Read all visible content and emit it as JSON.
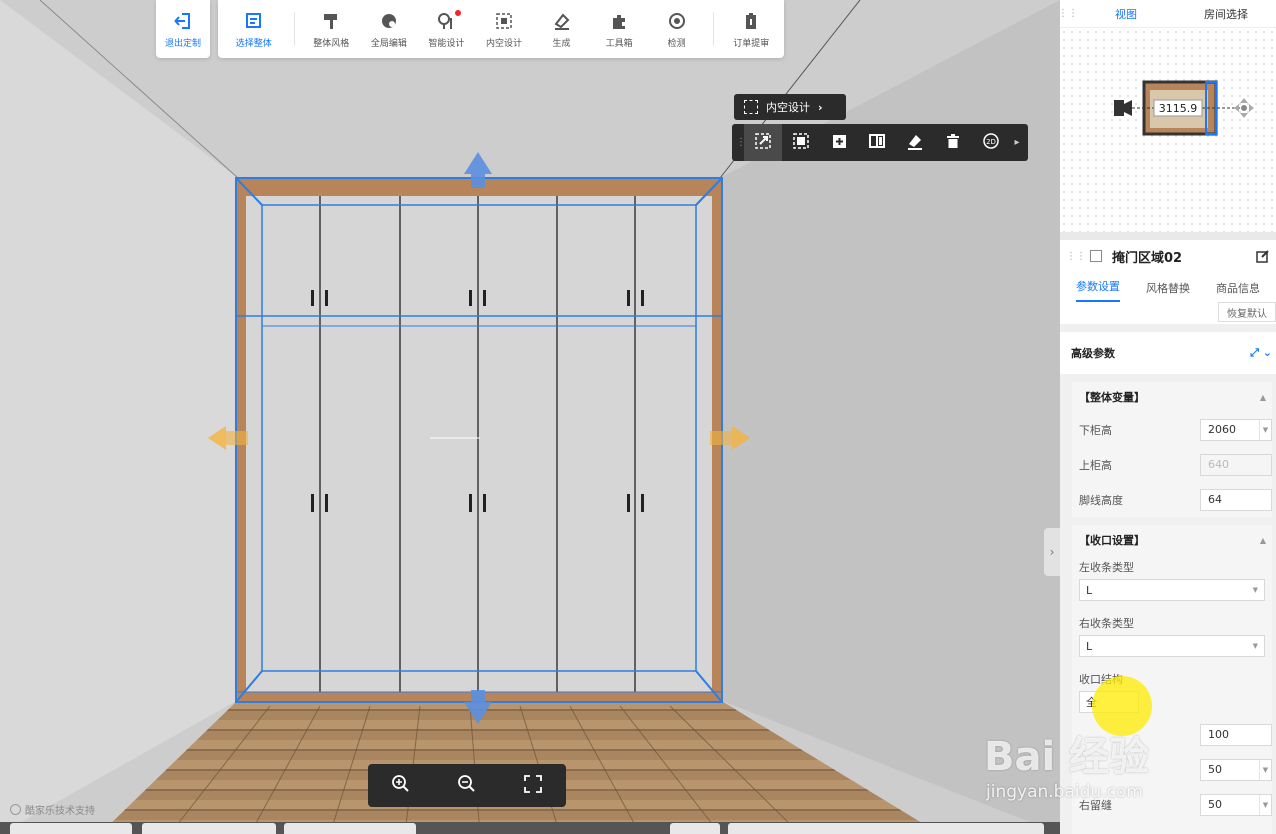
{
  "toolbar": {
    "exit_label": "退出定制",
    "items": [
      {
        "label": "选择整体",
        "icon": "select-whole-icon"
      },
      {
        "label": "整体风格",
        "icon": "paint-roller-icon"
      },
      {
        "label": "全局编辑",
        "icon": "global-edit-icon"
      },
      {
        "label": "智能设计",
        "icon": "smart-design-icon"
      },
      {
        "label": "内空设计",
        "icon": "interior-design-icon"
      },
      {
        "label": "生成",
        "icon": "generate-icon"
      },
      {
        "label": "工具箱",
        "icon": "puzzle-icon"
      },
      {
        "label": "检测",
        "icon": "detect-icon"
      },
      {
        "label": "订单提审",
        "icon": "order-submit-icon"
      }
    ]
  },
  "floating": {
    "tag_label": "内空设计",
    "tools": [
      "resize-icon",
      "select-region-icon",
      "add-icon",
      "split-icon",
      "brush-icon",
      "delete-icon",
      "2d-toggle-icon"
    ]
  },
  "zoom": {
    "buttons": [
      "zoom-in-icon",
      "zoom-out-icon",
      "fullscreen-icon"
    ]
  },
  "support_text": "酷家乐技术支持",
  "view_panel": {
    "tabs": [
      "视图",
      "房间选择"
    ],
    "active_tab": 0,
    "dimension": "3115.9"
  },
  "properties": {
    "title": "掩门区域02",
    "tabs": [
      "参数设置",
      "风格替换",
      "商品信息"
    ],
    "active_tab": 0,
    "restore_label": "恢复默认",
    "advanced_label": "高级参数",
    "group_overall": {
      "title": "【整体变量】",
      "fields": [
        {
          "label": "下柜高",
          "value": "2060",
          "disabled": false
        },
        {
          "label": "上柜高",
          "value": "640",
          "disabled": true
        },
        {
          "label": "脚线高度",
          "value": "64",
          "disabled": false
        }
      ]
    },
    "group_closing": {
      "title": "【收口设置】",
      "left_type_label": "左收条类型",
      "left_type_value": "L",
      "right_type_label": "右收条类型",
      "right_type_value": "L",
      "structure_label": "收口结构",
      "structure_value": "全",
      "extra_values": [
        "100",
        "50",
        "50"
      ],
      "right_gap_label": "右留缝"
    }
  },
  "watermark": {
    "text": "Bai 经验",
    "url": "jingyan.baidu.com"
  },
  "colors": {
    "accent": "#1677ff",
    "toolbar_dark": "#2b2b2b",
    "wood": "#b8855a",
    "selection": "#2f7de1"
  }
}
